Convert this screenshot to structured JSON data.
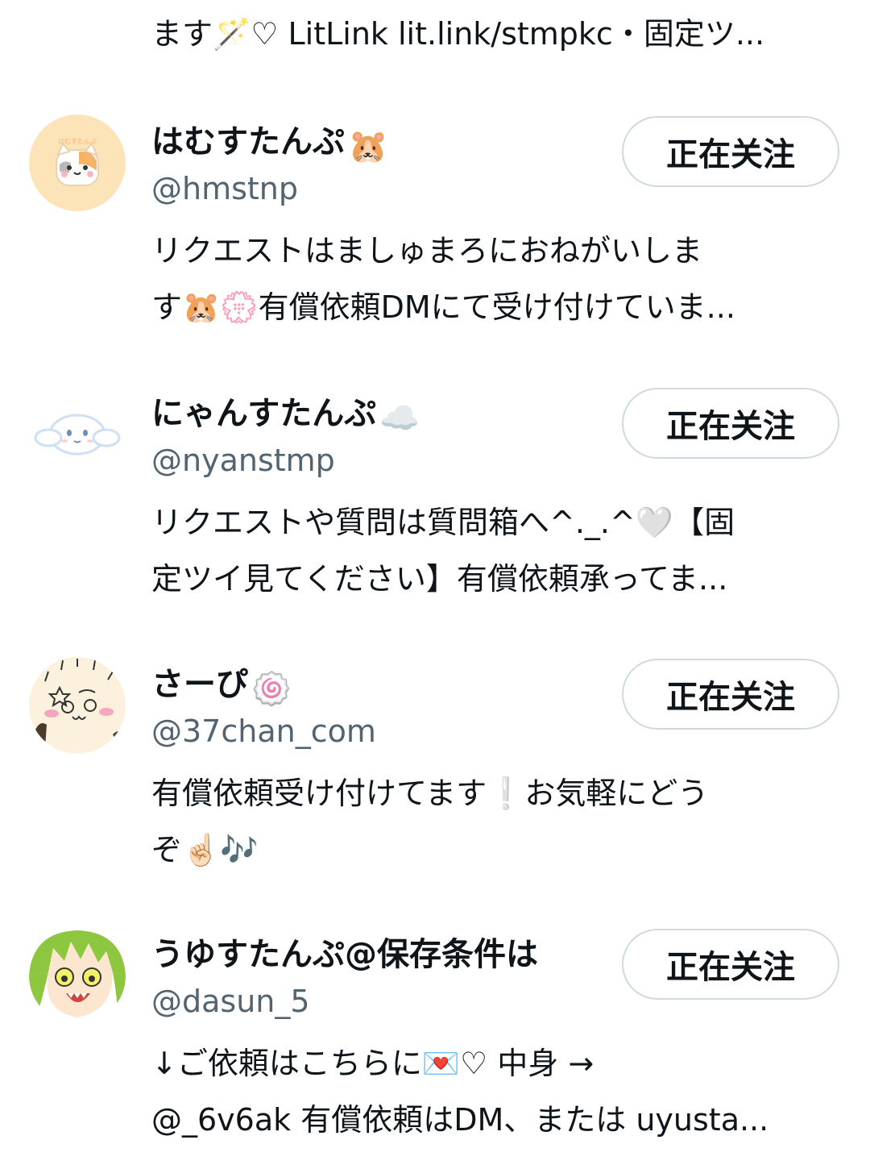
{
  "top_bio": {
    "text": "ます🪄♡ LitLink lit.link/stmpkc・固定ツ..."
  },
  "users": [
    {
      "name": "はむすたんぷ",
      "name_emoji": "🐹",
      "handle": "@hmstnp",
      "follow_label": "正在关注",
      "bio_lines": [
        "リクエストはましゅまろにおねがいしま",
        "す🐹💮有償依頼DMにて受け付けていま..."
      ],
      "avatar_icon": "hamster-avatar-icon",
      "avatar_color": "#fde3b8"
    },
    {
      "name": "にゃんすたんぷ",
      "name_emoji": "☁️",
      "handle": "@nyanstmp",
      "follow_label": "正在关注",
      "bio_lines": [
        "リクエストや質問は質問箱へ^._.^🤍【固",
        "定ツイ見てください】有償依頼承ってま..."
      ],
      "avatar_icon": "white-dog-avatar-icon",
      "avatar_color": "#ffffff"
    },
    {
      "name": "さーぴ",
      "name_emoji": "🍥",
      "handle": "@37chan_com",
      "follow_label": "正在关注",
      "bio_lines": [
        "有償依頼受け付けてます❕お気軽にどう",
        "ぞ☝🏻🎶"
      ],
      "avatar_icon": "cartoon-face-avatar-icon",
      "avatar_color": "#fbf1dc"
    },
    {
      "name": "うゆすたんぷ@保存条件は",
      "name_emoji": "",
      "handle": "@dasun_5",
      "follow_label": "正在关注",
      "bio_lines": [
        "↓ご依頼はこちらに💌♡ 中身 →",
        "@_6v6ak 有償依頼はDM、または uyusta..."
      ],
      "avatar_icon": "green-hair-character-avatar-icon",
      "avatar_color": "#8dc63f"
    }
  ]
}
